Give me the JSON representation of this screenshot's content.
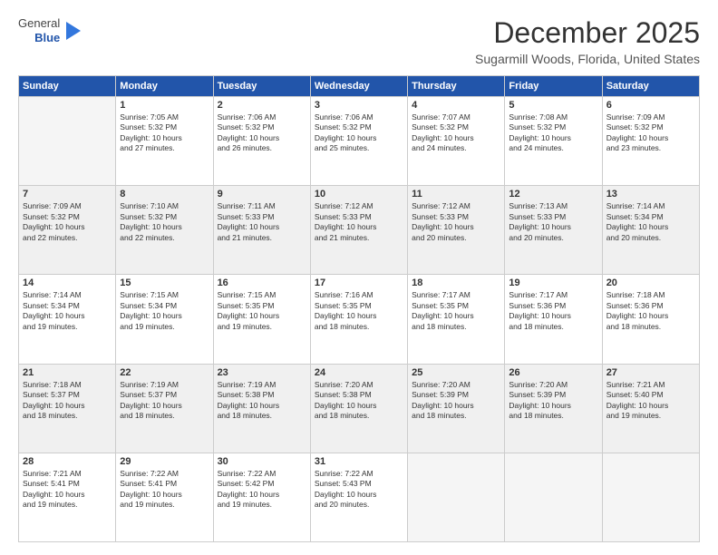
{
  "logo": {
    "line1": "General",
    "line2": "Blue"
  },
  "header": {
    "title": "December 2025",
    "subtitle": "Sugarmill Woods, Florida, United States"
  },
  "weekdays": [
    "Sunday",
    "Monday",
    "Tuesday",
    "Wednesday",
    "Thursday",
    "Friday",
    "Saturday"
  ],
  "weeks": [
    [
      {
        "day": "",
        "info": ""
      },
      {
        "day": "1",
        "info": "Sunrise: 7:05 AM\nSunset: 5:32 PM\nDaylight: 10 hours\nand 27 minutes."
      },
      {
        "day": "2",
        "info": "Sunrise: 7:06 AM\nSunset: 5:32 PM\nDaylight: 10 hours\nand 26 minutes."
      },
      {
        "day": "3",
        "info": "Sunrise: 7:06 AM\nSunset: 5:32 PM\nDaylight: 10 hours\nand 25 minutes."
      },
      {
        "day": "4",
        "info": "Sunrise: 7:07 AM\nSunset: 5:32 PM\nDaylight: 10 hours\nand 24 minutes."
      },
      {
        "day": "5",
        "info": "Sunrise: 7:08 AM\nSunset: 5:32 PM\nDaylight: 10 hours\nand 24 minutes."
      },
      {
        "day": "6",
        "info": "Sunrise: 7:09 AM\nSunset: 5:32 PM\nDaylight: 10 hours\nand 23 minutes."
      }
    ],
    [
      {
        "day": "7",
        "info": "Sunrise: 7:09 AM\nSunset: 5:32 PM\nDaylight: 10 hours\nand 22 minutes."
      },
      {
        "day": "8",
        "info": "Sunrise: 7:10 AM\nSunset: 5:32 PM\nDaylight: 10 hours\nand 22 minutes."
      },
      {
        "day": "9",
        "info": "Sunrise: 7:11 AM\nSunset: 5:33 PM\nDaylight: 10 hours\nand 21 minutes."
      },
      {
        "day": "10",
        "info": "Sunrise: 7:12 AM\nSunset: 5:33 PM\nDaylight: 10 hours\nand 21 minutes."
      },
      {
        "day": "11",
        "info": "Sunrise: 7:12 AM\nSunset: 5:33 PM\nDaylight: 10 hours\nand 20 minutes."
      },
      {
        "day": "12",
        "info": "Sunrise: 7:13 AM\nSunset: 5:33 PM\nDaylight: 10 hours\nand 20 minutes."
      },
      {
        "day": "13",
        "info": "Sunrise: 7:14 AM\nSunset: 5:34 PM\nDaylight: 10 hours\nand 20 minutes."
      }
    ],
    [
      {
        "day": "14",
        "info": "Sunrise: 7:14 AM\nSunset: 5:34 PM\nDaylight: 10 hours\nand 19 minutes."
      },
      {
        "day": "15",
        "info": "Sunrise: 7:15 AM\nSunset: 5:34 PM\nDaylight: 10 hours\nand 19 minutes."
      },
      {
        "day": "16",
        "info": "Sunrise: 7:15 AM\nSunset: 5:35 PM\nDaylight: 10 hours\nand 19 minutes."
      },
      {
        "day": "17",
        "info": "Sunrise: 7:16 AM\nSunset: 5:35 PM\nDaylight: 10 hours\nand 18 minutes."
      },
      {
        "day": "18",
        "info": "Sunrise: 7:17 AM\nSunset: 5:35 PM\nDaylight: 10 hours\nand 18 minutes."
      },
      {
        "day": "19",
        "info": "Sunrise: 7:17 AM\nSunset: 5:36 PM\nDaylight: 10 hours\nand 18 minutes."
      },
      {
        "day": "20",
        "info": "Sunrise: 7:18 AM\nSunset: 5:36 PM\nDaylight: 10 hours\nand 18 minutes."
      }
    ],
    [
      {
        "day": "21",
        "info": "Sunrise: 7:18 AM\nSunset: 5:37 PM\nDaylight: 10 hours\nand 18 minutes."
      },
      {
        "day": "22",
        "info": "Sunrise: 7:19 AM\nSunset: 5:37 PM\nDaylight: 10 hours\nand 18 minutes."
      },
      {
        "day": "23",
        "info": "Sunrise: 7:19 AM\nSunset: 5:38 PM\nDaylight: 10 hours\nand 18 minutes."
      },
      {
        "day": "24",
        "info": "Sunrise: 7:20 AM\nSunset: 5:38 PM\nDaylight: 10 hours\nand 18 minutes."
      },
      {
        "day": "25",
        "info": "Sunrise: 7:20 AM\nSunset: 5:39 PM\nDaylight: 10 hours\nand 18 minutes."
      },
      {
        "day": "26",
        "info": "Sunrise: 7:20 AM\nSunset: 5:39 PM\nDaylight: 10 hours\nand 18 minutes."
      },
      {
        "day": "27",
        "info": "Sunrise: 7:21 AM\nSunset: 5:40 PM\nDaylight: 10 hours\nand 19 minutes."
      }
    ],
    [
      {
        "day": "28",
        "info": "Sunrise: 7:21 AM\nSunset: 5:41 PM\nDaylight: 10 hours\nand 19 minutes."
      },
      {
        "day": "29",
        "info": "Sunrise: 7:22 AM\nSunset: 5:41 PM\nDaylight: 10 hours\nand 19 minutes."
      },
      {
        "day": "30",
        "info": "Sunrise: 7:22 AM\nSunset: 5:42 PM\nDaylight: 10 hours\nand 19 minutes."
      },
      {
        "day": "31",
        "info": "Sunrise: 7:22 AM\nSunset: 5:43 PM\nDaylight: 10 hours\nand 20 minutes."
      },
      {
        "day": "",
        "info": ""
      },
      {
        "day": "",
        "info": ""
      },
      {
        "day": "",
        "info": ""
      }
    ]
  ]
}
